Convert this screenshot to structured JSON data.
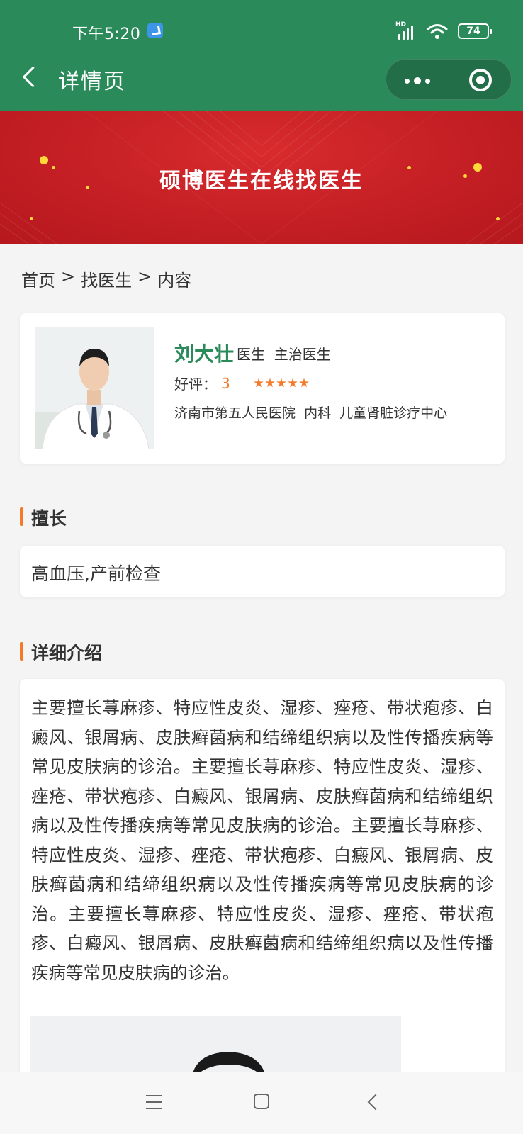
{
  "status_bar": {
    "time": "下午5:20",
    "network": "HD",
    "battery": "74"
  },
  "nav": {
    "title": "详情页"
  },
  "banner": {
    "title": "硕博医生在线找医生"
  },
  "breadcrumb": {
    "home": "首页",
    "sep1": ">",
    "level2": "找医生",
    "sep2": ">",
    "current": "内容"
  },
  "doctor": {
    "name": "刘大壮",
    "titles": "医生  主治医生",
    "rating_label": "好评：",
    "rating_value": "3",
    "stars": 5,
    "hospital": "济南市第五人民医院  内科  儿童肾脏诊疗中心"
  },
  "specialty": {
    "heading": "擅长",
    "text": "高血压,产前检查"
  },
  "intro": {
    "heading": "详细介绍",
    "text": "主要擅长荨麻疹、特应性皮炎、湿疹、痤疮、带状疱疹、白癜风、银屑病、皮肤癣菌病和结缔组织病以及性传播疾病等常见皮肤病的诊治。主要擅长荨麻疹、特应性皮炎、湿疹、痤疮、带状疱疹、白癜风、银屑病、皮肤癣菌病和结缔组织病以及性传播疾病等常见皮肤病的诊治。主要擅长荨麻疹、特应性皮炎、湿疹、痤疮、带状疱疹、白癜风、银屑病、皮肤癣菌病和结缔组织病以及性传播疾病等常见皮肤病的诊治。主要擅长荨麻疹、特应性皮炎、湿疹、痤疮、带状疱疹、白癜风、银屑病、皮肤癣菌病和结缔组织病以及性传播疾病等常见皮肤病的诊治。"
  },
  "colors": {
    "header_green": "#2a8a5a",
    "banner_red": "#c41f24",
    "accent_orange": "#f27a2a"
  },
  "icons": {
    "back": "chevron-left-icon",
    "more": "more-dots-icon",
    "close": "target-close-icon",
    "menu": "menu-icon",
    "home": "home-square-icon",
    "sys_back": "back-icon"
  }
}
